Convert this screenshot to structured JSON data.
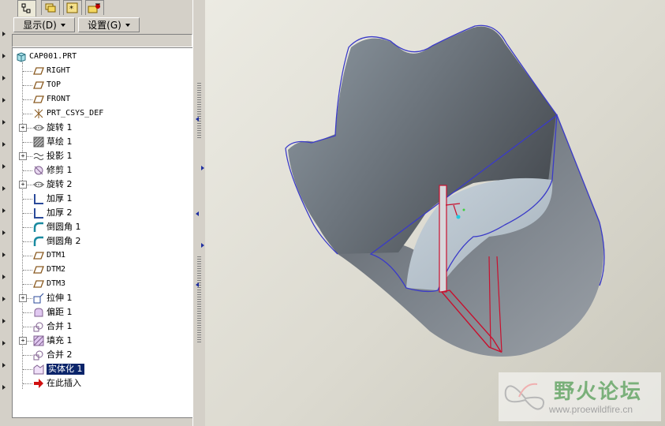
{
  "menubar": {
    "display": "显示(D)",
    "settings": "设置(G)"
  },
  "tree": {
    "items": [
      {
        "label": "CAP001.PRT",
        "icon": "part-icon"
      },
      {
        "label": "RIGHT",
        "icon": "datum-plane-icon"
      },
      {
        "label": "TOP",
        "icon": "datum-plane-icon"
      },
      {
        "label": "FRONT",
        "icon": "datum-plane-icon"
      },
      {
        "label": "PRT_CSYS_DEF",
        "icon": "coordinate-system-icon"
      },
      {
        "label": "旋转 1",
        "icon": "revolve-icon"
      },
      {
        "label": "草绘 1",
        "icon": "sketch-icon"
      },
      {
        "label": "投影 1",
        "icon": "projection-icon"
      },
      {
        "label": "修剪 1",
        "icon": "trim-icon"
      },
      {
        "label": "旋转 2",
        "icon": "revolve-icon"
      },
      {
        "label": "加厚 1",
        "icon": "thicken-icon"
      },
      {
        "label": "加厚 2",
        "icon": "thicken-icon"
      },
      {
        "label": "倒圆角 1",
        "icon": "round-icon"
      },
      {
        "label": "倒圆角 2",
        "icon": "round-icon"
      },
      {
        "label": "DTM1",
        "icon": "datum-plane-icon"
      },
      {
        "label": "DTM2",
        "icon": "datum-plane-icon"
      },
      {
        "label": "DTM3",
        "icon": "datum-plane-icon"
      },
      {
        "label": "拉伸 1",
        "icon": "extrude-icon"
      },
      {
        "label": "偏距 1",
        "icon": "offset-icon"
      },
      {
        "label": "合并 1",
        "icon": "merge-icon"
      },
      {
        "label": "填充 1",
        "icon": "fill-icon"
      },
      {
        "label": "合并 2",
        "icon": "merge-icon"
      },
      {
        "label": "实体化 1",
        "icon": "solidify-icon"
      },
      {
        "label": "在此插入",
        "icon": "insert-here-arrow-icon"
      }
    ]
  },
  "watermark": {
    "title": "野火论坛",
    "url": "www.proewildfire.cn"
  },
  "colors": {
    "selection": "#0a246a",
    "model_edge": "#3a3ac8",
    "highlight": "#c8102e"
  }
}
